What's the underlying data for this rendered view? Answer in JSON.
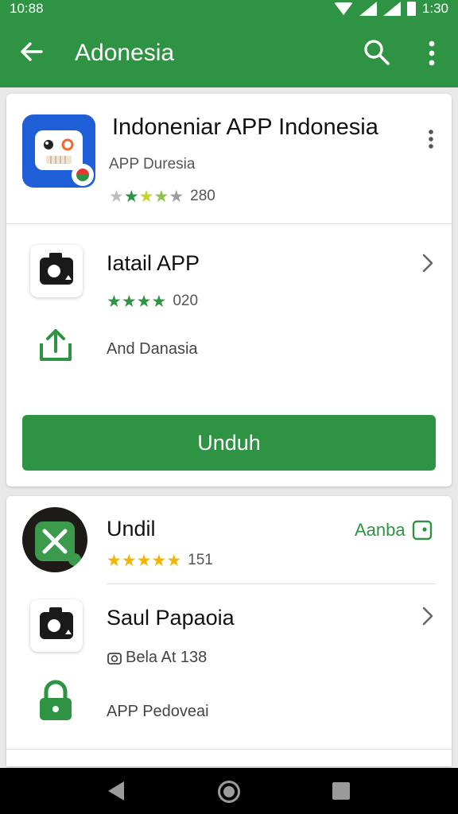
{
  "status_bar": {
    "time": "10:88",
    "clock": "1:30"
  },
  "app_bar": {
    "title": "Adonesia"
  },
  "hero": {
    "title": "Indoneniar APP Indonesia",
    "developer": "APP Duresia",
    "rating_stars": 4,
    "rating_count": "280"
  },
  "detail": {
    "title": "Iatail APP",
    "rating_stars": 4,
    "rating_count": "020",
    "share_label": "And Danasia",
    "primary_button": "Unduh"
  },
  "second_app": {
    "title": "Undil",
    "rating_stars": 5,
    "rating_count": "151",
    "install_label": "Aanba"
  },
  "third_item": {
    "title": "Saul Papaoia",
    "meta": "Bela At 138",
    "permission_label": "APP Pedoveai"
  },
  "colors": {
    "primary_green": "#2e9342",
    "star_yellow": "#f4b400",
    "star_green": "#2e9342",
    "hero_icon_blue": "#1e5fd8"
  }
}
